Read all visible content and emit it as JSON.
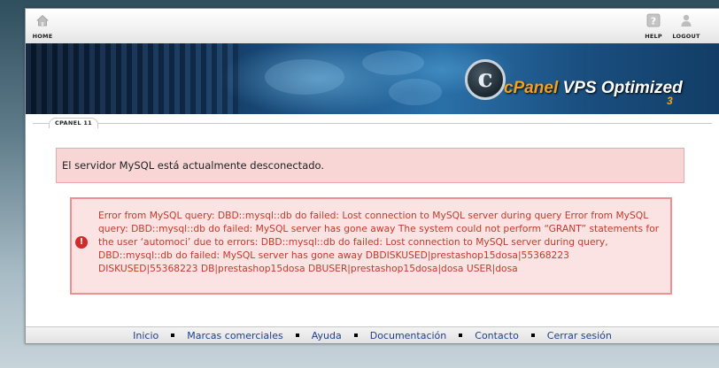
{
  "nav": {
    "home_label": "HOME",
    "help_label": "HELP",
    "logout_label": "LOGOUT"
  },
  "banner": {
    "logo_letter": "c",
    "brand": "cPanel",
    "product": " VPS Optimized",
    "version_badge": "3"
  },
  "breadcrumb": {
    "label": "CPANEL 11"
  },
  "notice": {
    "text": "El servidor MySQL está actualmente desconectado."
  },
  "error": {
    "icon": "!",
    "message": "Error from MySQL query: DBD::mysql::db do failed: Lost connection to MySQL server during query Error from MySQL query: DBD::mysql::db do failed: MySQL server has gone away The system could not perform “GRANT” statements for the user ‘automoci’ due to errors: DBD::mysql::db do failed: Lost connection to MySQL server during query, DBD::mysql::db do failed: MySQL server has gone away DBDISKUSED|prestashop15dosa|55368223 DISKUSED|55368223 DB|prestashop15dosa DBUSER|prestashop15dosa|dosa USER|dosa"
  },
  "footer": {
    "links": [
      "Inicio",
      "Marcas comerciales",
      "Ayuda",
      "Documentación",
      "Contacto",
      "Cerrar sesión"
    ]
  },
  "colors": {
    "notice_bg": "#f8d6d6",
    "error_border": "#ef8f8f",
    "error_text": "#c23b2b",
    "link": "#1f3f8c",
    "brand_orange": "#f3a21c"
  }
}
